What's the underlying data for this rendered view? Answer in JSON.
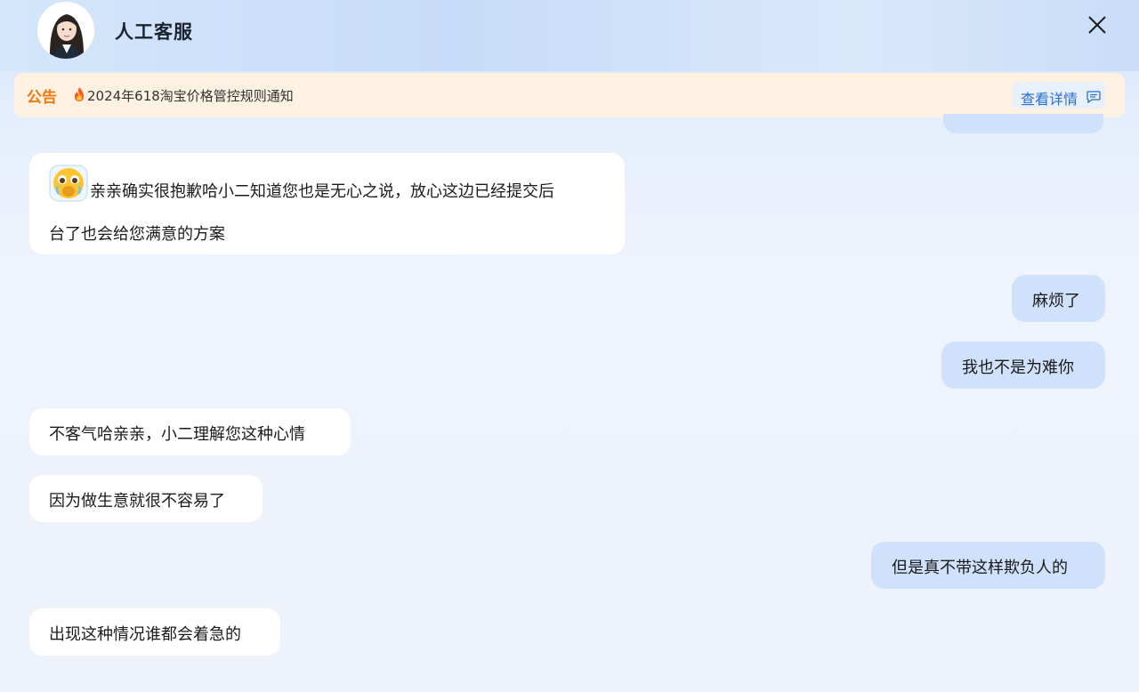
{
  "header": {
    "title": "人工客服"
  },
  "notice": {
    "label": "公告",
    "text": "2024年618淘宝价格管控规则通知",
    "detail_label": "查看详情"
  },
  "messages": [
    {
      "side": "agent",
      "line1": "亲亲确实很抱歉哈小二知道您也是无心之说，放心这边已经提交后",
      "line2": "台了也会给您满意的方案"
    },
    {
      "side": "user",
      "text": "麻烦了"
    },
    {
      "side": "user",
      "text": "我也不是为难你"
    },
    {
      "side": "agent",
      "text": "不客气哈亲亲，小二理解您这种心情"
    },
    {
      "side": "agent",
      "text": "因为做生意就很不容易了"
    },
    {
      "side": "user",
      "text": "但是真不带这样欺负人的"
    },
    {
      "side": "agent",
      "text": "出现这种情况谁都会着急的"
    }
  ],
  "colors": {
    "accent": "#f07a10",
    "link": "#2a6ec9",
    "user_bubble": "#cfe1fb",
    "agent_bubble": "#ffffff"
  },
  "icons": {
    "close": "close-icon",
    "fire": "fire-icon",
    "detail": "chat-bubble-icon",
    "emoji": "crying-face-emoji"
  }
}
